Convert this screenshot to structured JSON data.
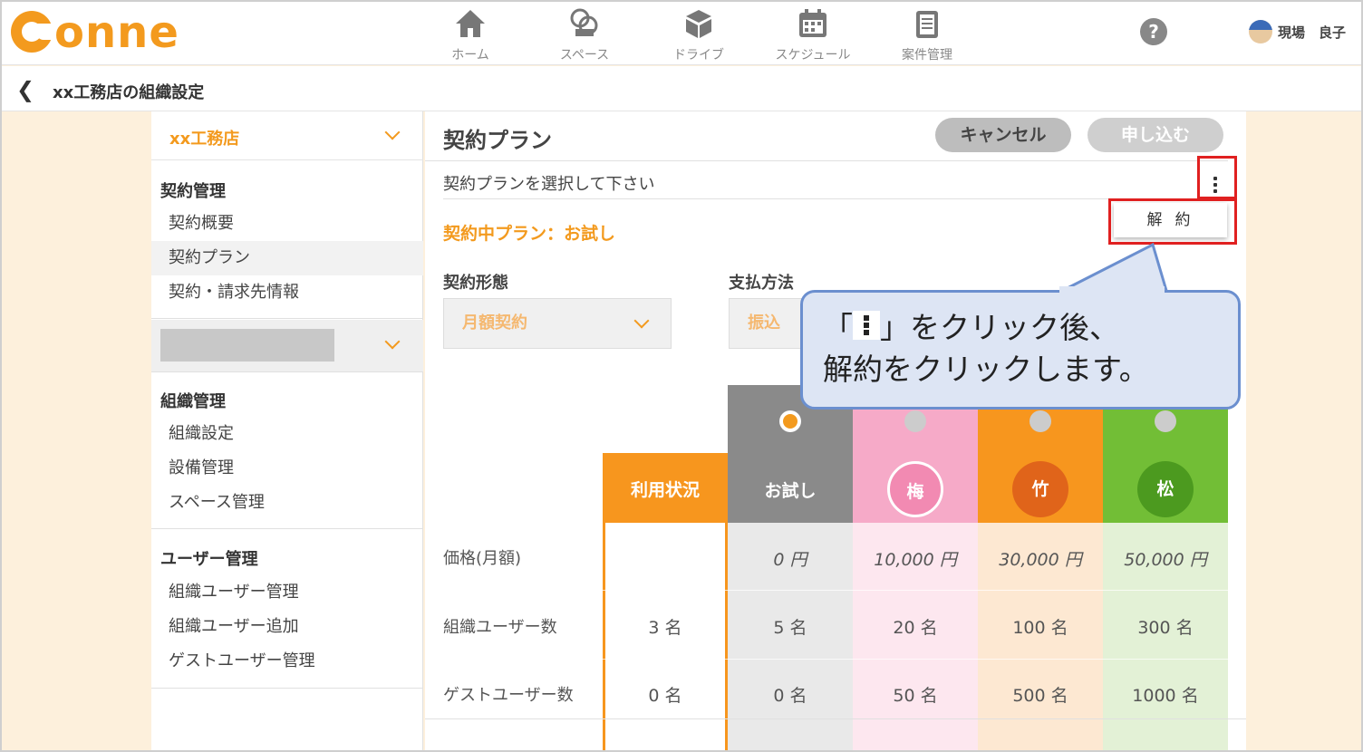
{
  "app": {
    "logo": "onne"
  },
  "nav": [
    {
      "label": "ホーム",
      "icon": "home-icon"
    },
    {
      "label": "スペース",
      "icon": "space-icon"
    },
    {
      "label": "ドライブ",
      "icon": "drive-icon"
    },
    {
      "label": "スケジュール",
      "icon": "calendar-icon"
    },
    {
      "label": "案件管理",
      "icon": "clipboard-icon"
    }
  ],
  "header": {
    "help": "?",
    "user_name": "現場　良子"
  },
  "breadcrumb": {
    "title": "xx工務店の組織設定"
  },
  "sidebar": {
    "org_name": "xx工務店",
    "sections": [
      {
        "heading": "契約管理",
        "items": [
          "契約概要",
          "契約プラン",
          "契約・請求先情報"
        ]
      },
      {
        "heading": "組織管理",
        "items": [
          "組織設定",
          "設備管理",
          "スペース管理"
        ]
      },
      {
        "heading": "ユーザー管理",
        "items": [
          "組織ユーザー管理",
          "組織ユーザー追加",
          "ゲストユーザー管理"
        ]
      }
    ]
  },
  "main": {
    "title": "契約プラン",
    "cancel_label": "キャンセル",
    "apply_label": "申し込む",
    "prompt": "契約プランを選択して下さい",
    "menu_item": "解約",
    "current_plan": "契約中プラン：お試し",
    "contract_type_label": "契約形態",
    "contract_type_value": "月額契約",
    "payment_label": "支払方法",
    "payment_value": "振込"
  },
  "plans": {
    "usage_header": "利用状況",
    "row_labels": [
      "価格(月額)",
      "組織ユーザー数",
      "ゲストユーザー数"
    ],
    "usage": {
      "price": "",
      "org_users": "3 名",
      "guest_users": "0 名"
    },
    "columns": [
      {
        "name": "お試し",
        "price": "0 円",
        "org_users": "5 名",
        "guest_users": "0 名",
        "selected": true,
        "color": "#8a8a8a"
      },
      {
        "name": "梅",
        "price": "10,000 円",
        "org_users": "20 名",
        "guest_users": "50 名",
        "selected": false,
        "color": "#f3a9c6"
      },
      {
        "name": "竹",
        "price": "30,000 円",
        "org_users": "100 名",
        "guest_users": "500 名",
        "selected": false,
        "color": "#f7961e"
      },
      {
        "name": "松",
        "price": "50,000 円",
        "org_users": "300 名",
        "guest_users": "1000 名",
        "selected": false,
        "color": "#72be36"
      }
    ]
  },
  "callout": {
    "line1_prefix": "「",
    "line1_suffix": "」をクリック後、",
    "line2": "解約をクリックします。"
  }
}
